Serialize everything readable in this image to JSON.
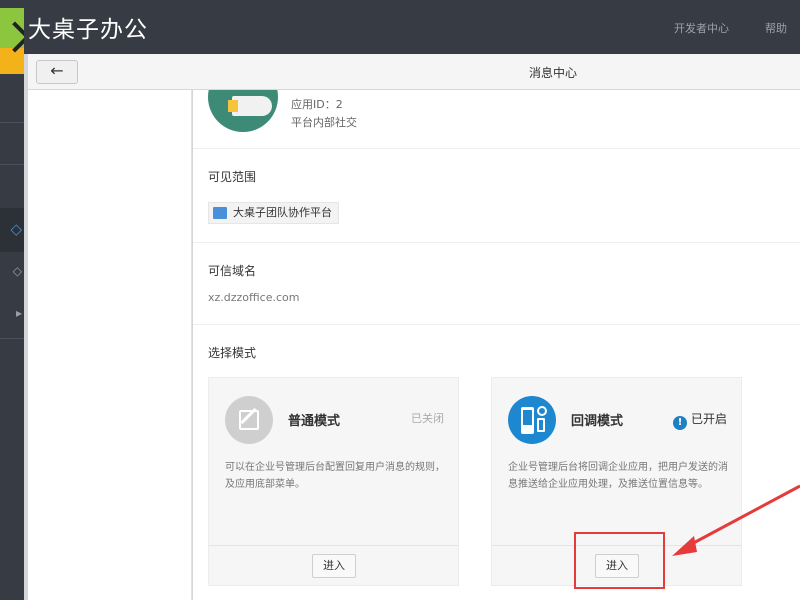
{
  "app_title": "大桌子办公",
  "header_links": {
    "developer_center": "开发者中心",
    "help": "帮助"
  },
  "window": {
    "title": "消息中心",
    "back_icon": "←"
  },
  "app_info": {
    "id": "应用ID：2",
    "description": "平台内部社交"
  },
  "visible_scope": {
    "label": "可见范围",
    "tag": "大桌子团队协作平台"
  },
  "trusted_domain": {
    "label": "可信域名",
    "value": "xz.dzzoffice.com"
  },
  "mode_select": {
    "label": "选择模式",
    "normal": {
      "name": "普通模式",
      "status": "已关闭",
      "description": "可以在企业号管理后台配置回复用户消息的规则，及应用底部菜单。",
      "button": "进入"
    },
    "callback": {
      "name": "回调模式",
      "status": "已开启",
      "status_icon": "!",
      "description": "企业号管理后台将回调企业应用，把用户发送的消息推送给企业应用处理，及推送位置信息等。",
      "button": "进入"
    }
  },
  "colors": {
    "header_bg": "#373c44",
    "accent_blue": "#1d87d0",
    "annotation_red": "#e53b3b",
    "avatar_green": "#3d8a77"
  }
}
